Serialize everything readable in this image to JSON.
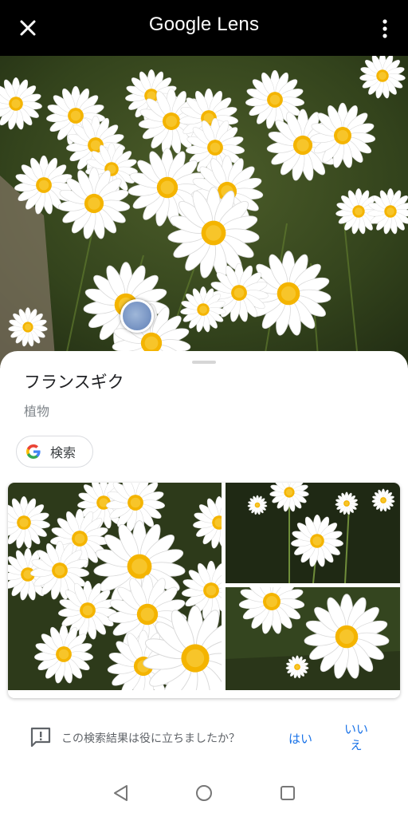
{
  "app": {
    "title": "Google Lens"
  },
  "topbar": {
    "close_icon": "close-icon",
    "more_icon": "more-vert-icon"
  },
  "result": {
    "title": "フランスギク",
    "subtitle": "植物"
  },
  "search": {
    "label": "検索",
    "icon": "google-g-icon"
  },
  "feedback": {
    "question": "この検索結果は役に立ちましたか？",
    "yes": "はい",
    "no": "いいえ",
    "icon": "feedback-icon"
  },
  "navbar": {
    "back_icon": "back-triangle-icon",
    "home_icon": "home-circle-icon",
    "recent_icon": "recent-square-icon"
  },
  "colors": {
    "accent": "#1a73e8",
    "sheet_bg": "#ffffff",
    "topbar_bg": "#000000"
  }
}
